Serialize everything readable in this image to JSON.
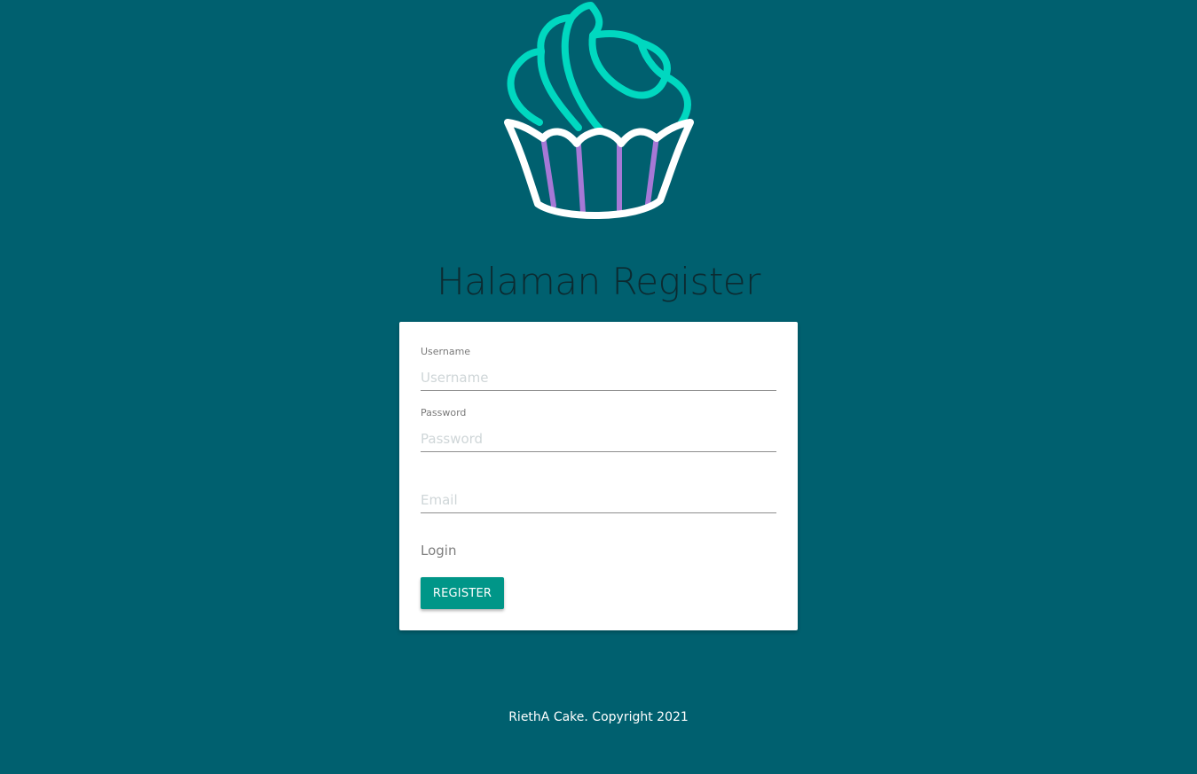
{
  "page": {
    "title": "Halaman Register",
    "background_color": "#00606f"
  },
  "logo": {
    "icon": "cupcake-icon",
    "colors": {
      "frosting": "#00d8c0",
      "wrapper": "#ffffff",
      "stripes": "#a678d6"
    }
  },
  "form": {
    "username": {
      "label": "Username",
      "placeholder": "Username",
      "value": ""
    },
    "password": {
      "label": "Password",
      "placeholder": "Password",
      "value": ""
    },
    "email": {
      "label": "",
      "placeholder": "Email",
      "value": ""
    },
    "login_link": "Login",
    "register_button": "REGISTER",
    "accent_color": "#009688"
  },
  "footer": {
    "text": "RiethA Cake. Copyright 2021"
  }
}
